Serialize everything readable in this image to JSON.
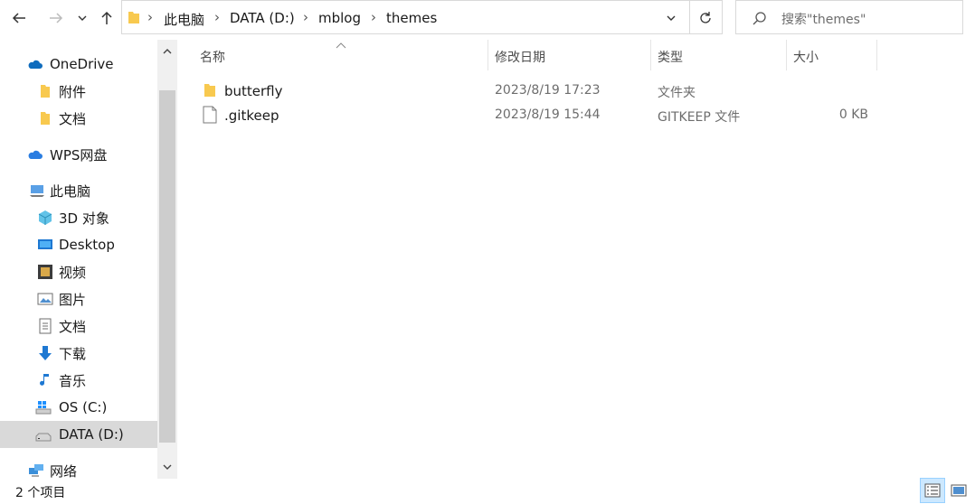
{
  "nav": {
    "back_icon": "arrow-left-icon",
    "forward_icon": "arrow-right-icon",
    "recent_icon": "chevron-down-icon",
    "up_icon": "arrow-up-icon"
  },
  "address": {
    "breadcrumbs": [
      "此电脑",
      "DATA (D:)",
      "mblog",
      "themes"
    ]
  },
  "search": {
    "placeholder": "搜索\"themes\""
  },
  "sidebar": {
    "items": [
      {
        "label": "OneDrive",
        "icon": "cloud-icon"
      },
      {
        "label": "附件",
        "icon": "folder-icon"
      },
      {
        "label": "文档",
        "icon": "folder-icon"
      },
      {
        "label": "WPS网盘",
        "icon": "cloud-icon"
      },
      {
        "label": "此电脑",
        "icon": "computer-icon"
      },
      {
        "label": "3D 对象",
        "icon": "cube-icon"
      },
      {
        "label": "Desktop",
        "icon": "desktop-icon"
      },
      {
        "label": "视频",
        "icon": "video-icon"
      },
      {
        "label": "图片",
        "icon": "picture-icon"
      },
      {
        "label": "文档",
        "icon": "document-icon"
      },
      {
        "label": "下载",
        "icon": "download-icon"
      },
      {
        "label": "音乐",
        "icon": "music-icon"
      },
      {
        "label": "OS (C:)",
        "icon": "windows-drive-icon"
      },
      {
        "label": "DATA (D:)",
        "icon": "drive-icon"
      },
      {
        "label": "网络",
        "icon": "network-icon"
      }
    ]
  },
  "columns": {
    "name": "名称",
    "modified": "修改日期",
    "type": "类型",
    "size": "大小"
  },
  "files": [
    {
      "name": "butterfly",
      "modified": "2023/8/19 17:23",
      "type": "文件夹",
      "size": "",
      "icon": "folder-icon"
    },
    {
      "name": ".gitkeep",
      "modified": "2023/8/19 15:44",
      "type": "GITKEEP 文件",
      "size": "0 KB",
      "icon": "file-icon"
    }
  ],
  "status": {
    "item_count": "2 个项目"
  },
  "colors": {
    "folder": "#f8c94f",
    "selected": "#d9d9d9",
    "onedrive": "#0f6cbd"
  }
}
